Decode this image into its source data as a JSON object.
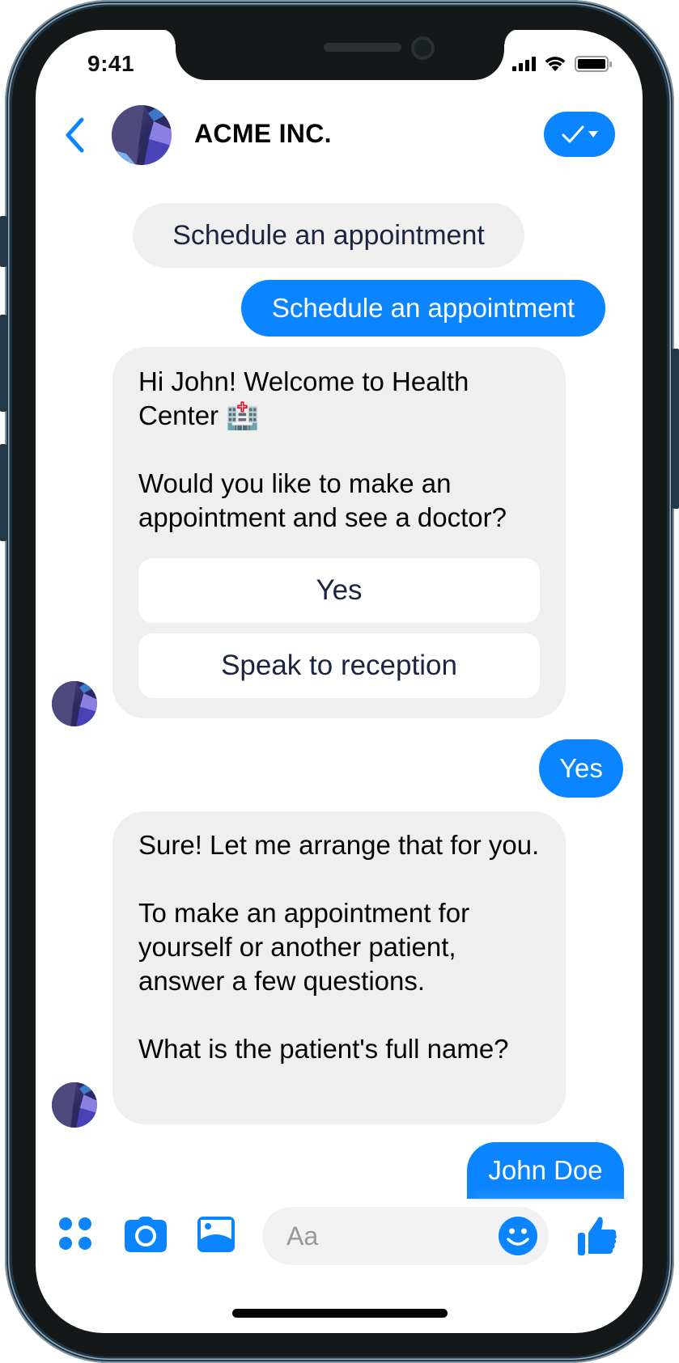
{
  "status_bar": {
    "time": "9:41",
    "icons": [
      "cellular-signal-icon",
      "wifi-icon",
      "battery-icon"
    ]
  },
  "header": {
    "back_icon": "chevron-left-icon",
    "title": "ACME INC.",
    "action_icons": [
      "checkmark-icon",
      "caret-down-icon"
    ]
  },
  "theme": {
    "accent": "#0a84ff",
    "incoming_bubble": "#efefef",
    "quick_reply_text": "#1c2540"
  },
  "messages": [
    {
      "type": "postback-label",
      "text": "Schedule an appointment"
    },
    {
      "type": "outgoing",
      "text": "Schedule an appointment"
    },
    {
      "type": "incoming",
      "text": "Hi John! Welcome to Health Center 🏥\n\nWould you like to make an appointment and see a doctor?",
      "buttons": [
        {
          "label": "Yes"
        },
        {
          "label": "Speak to reception"
        }
      ]
    },
    {
      "type": "outgoing",
      "text": "Yes"
    },
    {
      "type": "incoming",
      "text": "Sure! Let me arrange that for you.\n\nTo make an appointment for yourself or another patient, answer a few questions.\n\nWhat is the patient's full name?"
    },
    {
      "type": "outgoing",
      "text": "John Doe"
    }
  ],
  "composer": {
    "placeholder": "Aa",
    "value": "",
    "tool_icons": [
      "apps-grid-icon",
      "camera-icon",
      "image-icon"
    ],
    "emoji_icon": "smiley-icon",
    "like_icon": "thumbs-up-icon"
  }
}
